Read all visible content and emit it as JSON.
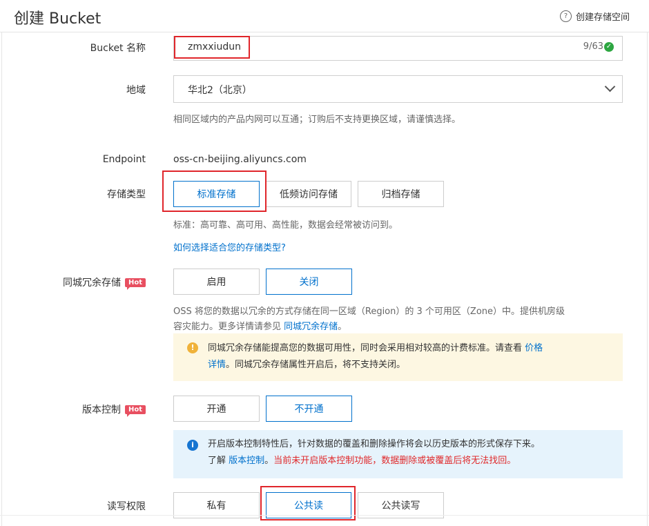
{
  "header": {
    "title": "创建 Bucket",
    "help_label": "创建存储空间",
    "help_icon": "question-circle-icon"
  },
  "bucket_name": {
    "label": "Bucket 名称",
    "value": "zmxxiudun",
    "counter": "9/63"
  },
  "region": {
    "label": "地域",
    "value": "华北2（北京）",
    "hint": "相同区域内的产品内网可以互通；订购后不支持更换区域，请谨慎选择。"
  },
  "endpoint": {
    "label": "Endpoint",
    "value": "oss-cn-beijing.aliyuncs.com"
  },
  "storage_class": {
    "label": "存储类型",
    "options": [
      "标准存储",
      "低频访问存储",
      "归档存储"
    ],
    "selected": "标准存储",
    "hint": "标准：高可靠、高可用、高性能，数据会经常被访问到。",
    "link": "如何选择适合您的存储类型?"
  },
  "zrs": {
    "label": "同城冗余存储",
    "badge": "Hot",
    "options": [
      "启用",
      "关闭"
    ],
    "selected": "关闭",
    "hint_line1": "OSS 将您的数据以冗余的方式存储在同一区域（Region）的 3 个可用区（Zone）中。提供机房级",
    "hint_line2": "容灾能力。更多详情请参见",
    "hint_link": "同城冗余存储",
    "hint_end": "。",
    "notice_line1": "同城冗余存储能提高您的数据可用性，同时会采用相对较高的计费标准。请查看",
    "notice_link1": "价格",
    "notice_link2": "详情",
    "notice_line2": "。同城冗余存储属性开启后，将不支持关闭。"
  },
  "versioning": {
    "label": "版本控制",
    "badge": "Hot",
    "options": [
      "开通",
      "不开通"
    ],
    "selected": "不开通",
    "notice_line1": "开启版本控制特性后，针对数据的覆盖和删除操作将会以历史版本的形式保存下来。",
    "notice_prefix": "了解",
    "notice_link": "版本控制",
    "notice_sep": "。",
    "notice_warning": "当前未开启版本控制功能，数据删除或被覆盖后将无法找回。"
  },
  "acl": {
    "label": "读写权限",
    "options": [
      "私有",
      "公共读",
      "公共读写"
    ],
    "selected": "公共读"
  },
  "colors": {
    "accent": "#0070cc",
    "highlight": "#e0252a",
    "hot": "#e84f60",
    "warning_bg": "#fdf7e2",
    "info_bg": "#e6f3fc",
    "danger_text": "#e0292b"
  }
}
